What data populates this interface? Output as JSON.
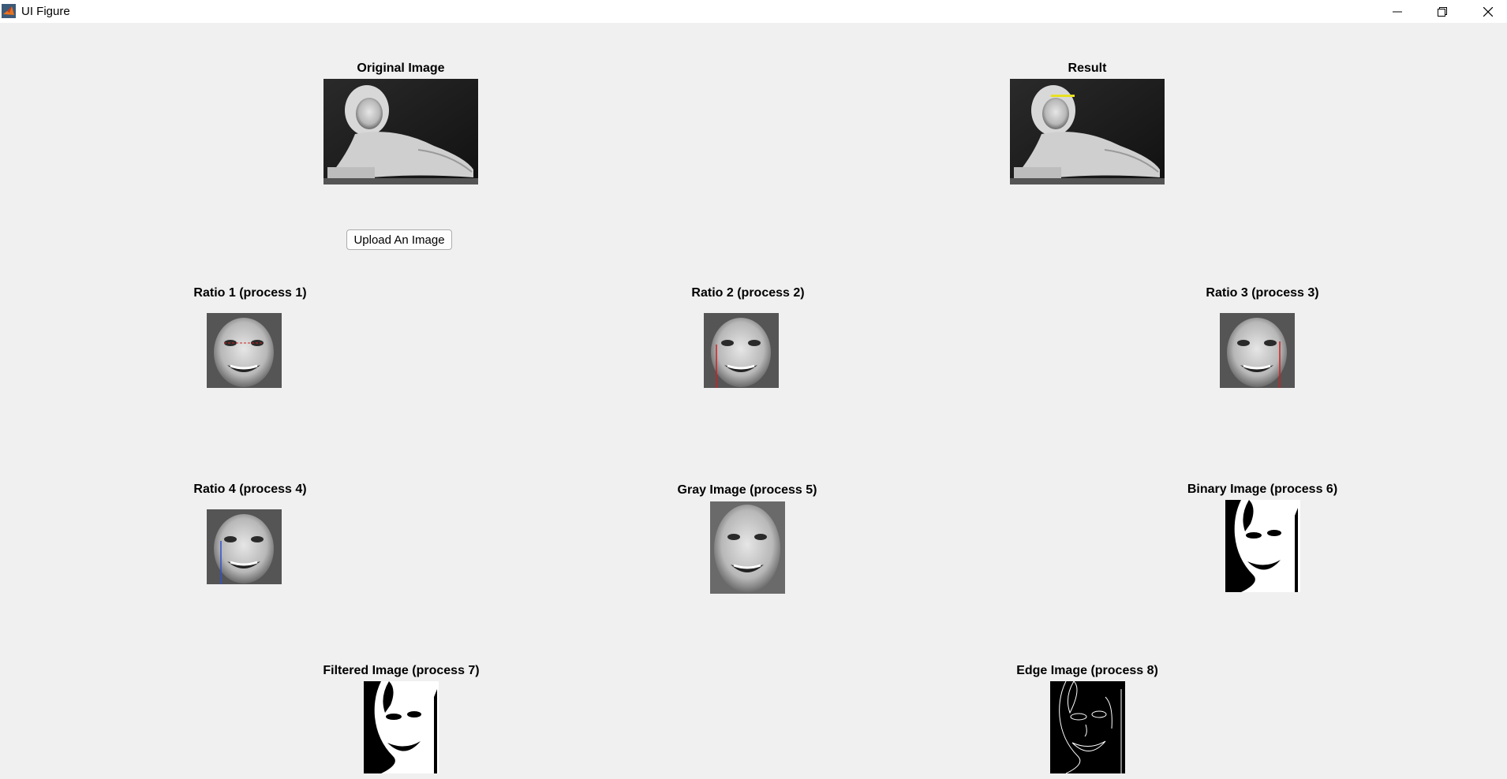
{
  "window": {
    "title": "UI Figure",
    "icons": [
      "matlab-logo-icon",
      "minimize-icon",
      "restore-icon",
      "close-icon"
    ]
  },
  "panels": {
    "original": {
      "title": "Original Image"
    },
    "result": {
      "title": "Result"
    },
    "ratio1": {
      "title": "Ratio 1 (process 1)"
    },
    "ratio2": {
      "title": "Ratio 2 (process 2)"
    },
    "ratio3": {
      "title": "Ratio 3 (process 3)"
    },
    "ratio4": {
      "title": "Ratio 4 (process 4)"
    },
    "gray": {
      "title": "Gray Image (process 5)"
    },
    "binary": {
      "title": "Binary Image (process 6)"
    },
    "filtered": {
      "title": "Filtered Image (process 7)"
    },
    "edge": {
      "title": "Edge Image (process 8)"
    }
  },
  "upload_button": {
    "label": "Upload An Image"
  },
  "colors": {
    "background": "#f0f0f0",
    "titlebar": "#ffffff",
    "result_marker": "#e8e020",
    "ratio_line_red": "#d02020",
    "ratio_line_blue": "#3050d0"
  }
}
